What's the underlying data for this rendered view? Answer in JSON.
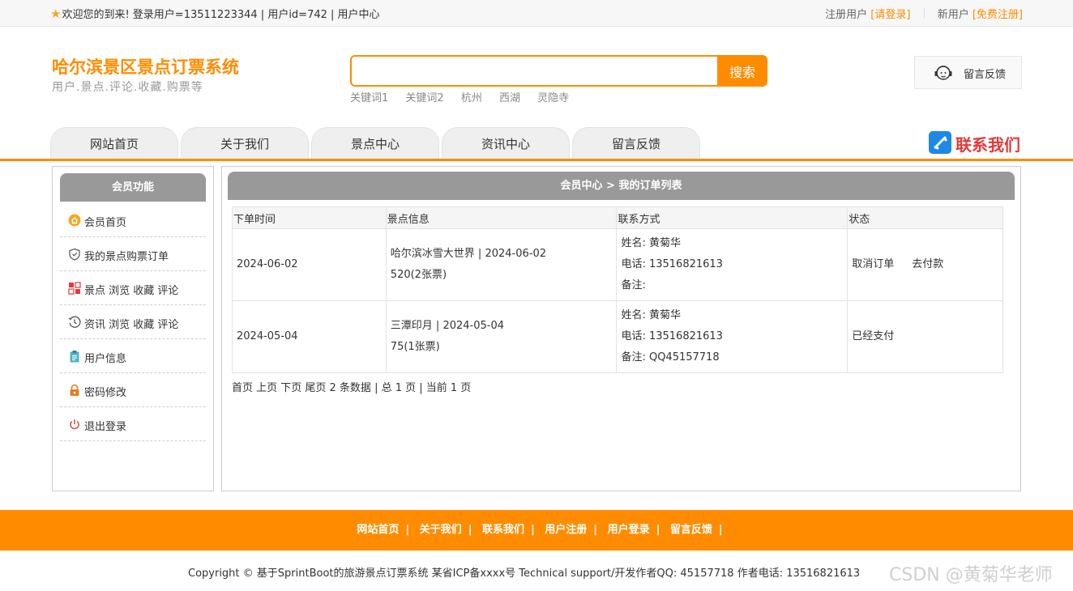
{
  "topbar": {
    "welcome": "欢迎您的到来!  登录用户=13511223344 | 用户id=742 | 用户中心",
    "register_user_label": "注册用户",
    "login_link": "[请登录]",
    "new_user_label": "新用户",
    "free_register_link": "[免费注册]"
  },
  "header": {
    "title": "哈尔滨景区景点订票系统",
    "subtitle": "用户.景点.评论.收藏.购票等",
    "search": {
      "placeholder": "",
      "button": "搜索"
    },
    "hotwords": [
      "关键词1",
      "关键词2",
      "杭州",
      "西湖",
      "灵隐寺"
    ],
    "feedback_label": "留言反馈"
  },
  "nav": {
    "tabs": [
      "网站首页",
      "关于我们",
      "景点中心",
      "资讯中心",
      "留言反馈"
    ],
    "contact_label": "联系我们"
  },
  "sidebar": {
    "title": "会员功能",
    "items": [
      {
        "label": "会员首页",
        "icon": "home-icon"
      },
      {
        "label": "我的景点购票订单",
        "icon": "shield-icon"
      },
      {
        "label": "景点 浏览 收藏 评论",
        "icon": "grid-icon"
      },
      {
        "label": "资讯 浏览 收藏 评论",
        "icon": "history-icon"
      },
      {
        "label": "用户信息",
        "icon": "clipboard-icon"
      },
      {
        "label": "密码修改",
        "icon": "lock-icon"
      },
      {
        "label": "退出登录",
        "icon": "power-icon"
      }
    ]
  },
  "main": {
    "breadcrumb": "会员中心 > 我的订单列表",
    "columns": [
      "下单时间",
      "景点信息",
      "联系方式",
      "状态"
    ],
    "rows": [
      {
        "time": "2024-06-02",
        "spot": "哈尔滨冰雪大世界 | 2024-06-02",
        "price": "520(2张票)",
        "name": "姓名: 黄菊华",
        "phone": "电话: 13516821613",
        "note": "备注: ",
        "status": [
          "取消订单",
          "去付款"
        ]
      },
      {
        "time": "2024-05-04",
        "spot": "三潭印月 | 2024-05-04",
        "price": "75(1张票)",
        "name": "姓名: 黄菊华",
        "phone": "电话: 13516821613",
        "note": "备注: QQ45157718",
        "status": [
          "已经支付"
        ]
      }
    ],
    "pager": "首页 上页 下页 尾页 2 条数据 | 总 1 页 | 当前 1 页"
  },
  "footer": {
    "links": [
      "网站首页",
      "关于我们",
      "联系我们",
      "用户注册",
      "用户登录",
      "留言反馈"
    ],
    "copyright": "Copyright © 基于SprintBoot的旅游景点订票系统    某省ICP备xxxx号    Technical support/开发作者QQ: 45157718    作者电话: 13516821613",
    "watermark": "CSDN @黄菊华老师"
  },
  "colors": {
    "accent": "#ff8c00",
    "header_gray": "#999999",
    "contact_red": "#e53935",
    "contact_blue": "#1e88e5"
  }
}
